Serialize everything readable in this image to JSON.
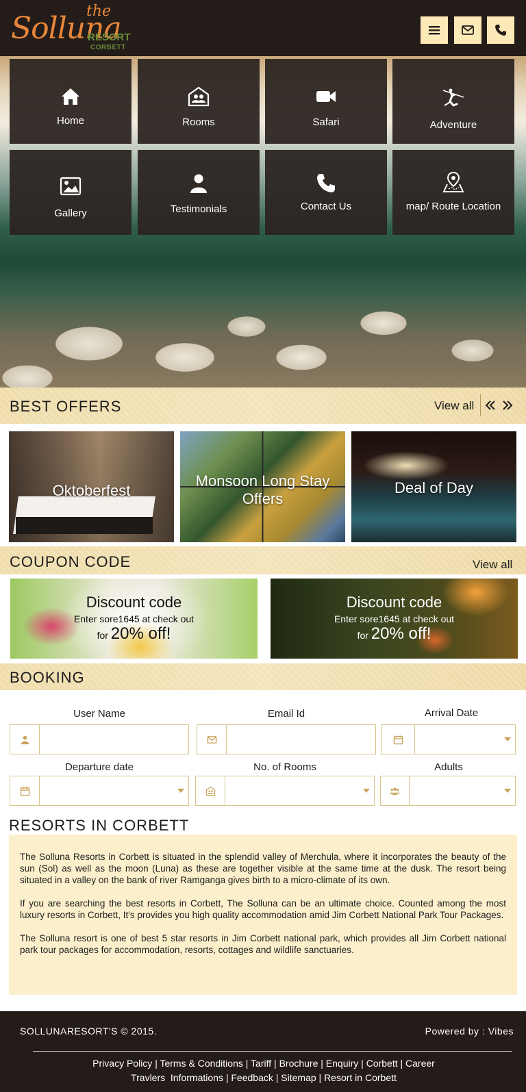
{
  "header": {
    "logo": {
      "the": "the",
      "brand": "Solluna",
      "resort": "RESORT",
      "location": "CORBETT"
    },
    "buttons": [
      {
        "name": "menu-icon"
      },
      {
        "name": "mail-icon"
      },
      {
        "name": "phone-icon"
      }
    ]
  },
  "nav": {
    "tiles": [
      {
        "label": "Home",
        "icon": "home-icon"
      },
      {
        "label": "Rooms",
        "icon": "rooms-icon"
      },
      {
        "label": "Safari",
        "icon": "video-camera-icon"
      },
      {
        "label": "Adventure",
        "icon": "zipline-icon"
      },
      {
        "label": "Gallery",
        "icon": "image-icon"
      },
      {
        "label": "Testimonials",
        "icon": "user-icon"
      },
      {
        "label": "Contact Us",
        "icon": "phone-icon"
      },
      {
        "label": "map/ Route Location",
        "icon": "map-pin-icon"
      }
    ]
  },
  "offers": {
    "title": "BEST OFFERS",
    "view_all": "View all",
    "items": [
      {
        "label": "Oktoberfest"
      },
      {
        "label": "Monsoon Long Stay Offers"
      },
      {
        "label": "Deal of Day"
      }
    ]
  },
  "coupons": {
    "title": "COUPON CODE",
    "view_all": "View all",
    "items": [
      {
        "heading": "Discount code",
        "line": "Enter sore1645 at check out",
        "for": "for",
        "amount": "20% off!"
      },
      {
        "heading": "Discount code",
        "line": "Enter sore1645 at check out",
        "for": "for",
        "amount": "20% off!"
      }
    ]
  },
  "booking": {
    "title": "BOOKING",
    "fields": {
      "user_name": "User Name",
      "email": "Email Id",
      "arrival": "Arrival Date",
      "departure": "Departure date",
      "rooms": "No. of Rooms",
      "adults": "Adults"
    }
  },
  "resorts": {
    "title": "RESORTS IN CORBETT",
    "paragraphs": [
      "The Solluna Resorts in Corbett is situated in the splendid valley of Merchula, where it incorporates the beauty of the sun (Sol) as well as the moon (Luna) as these are together visible at the same time at the dusk. The resort being situated in a valley on the bank of river Ramganga gives birth to a micro-climate of its own.",
      "If you are searching the best resorts in Corbett, The Solluna can be an ultimate choice. Counted among the most luxury resorts in Corbett, It's provides you high quality accommodation amid Jim Corbett National Park Tour Packages.",
      "The Solluna resort is one of best 5 star resorts in Jim Corbett national park, which provides all Jim Corbett national park tour packages for accommodation, resorts, cottages and wildlife sanctuaries."
    ]
  },
  "footer": {
    "copyright": "SOLLUNARESORT'S © 2015.",
    "powered": "Powered by : Vibes",
    "links_row1": [
      "Privacy Policy",
      "Terms & Conditions",
      "Tariff",
      "Brochure",
      "Enquiry",
      "Corbett",
      "Career"
    ],
    "links_row2": [
      "Travlers  Informations",
      "Feedback",
      "Sitemap",
      "Resort in Corbett"
    ],
    "separator": "|"
  },
  "colors": {
    "header_bg": "#241c18",
    "accent_cream": "#fbe9b7",
    "tile_bg": "#2c2421",
    "band_gold": "#efdcaa",
    "brand_orange": "#e8873a",
    "brand_green": "#6a8c3a"
  }
}
